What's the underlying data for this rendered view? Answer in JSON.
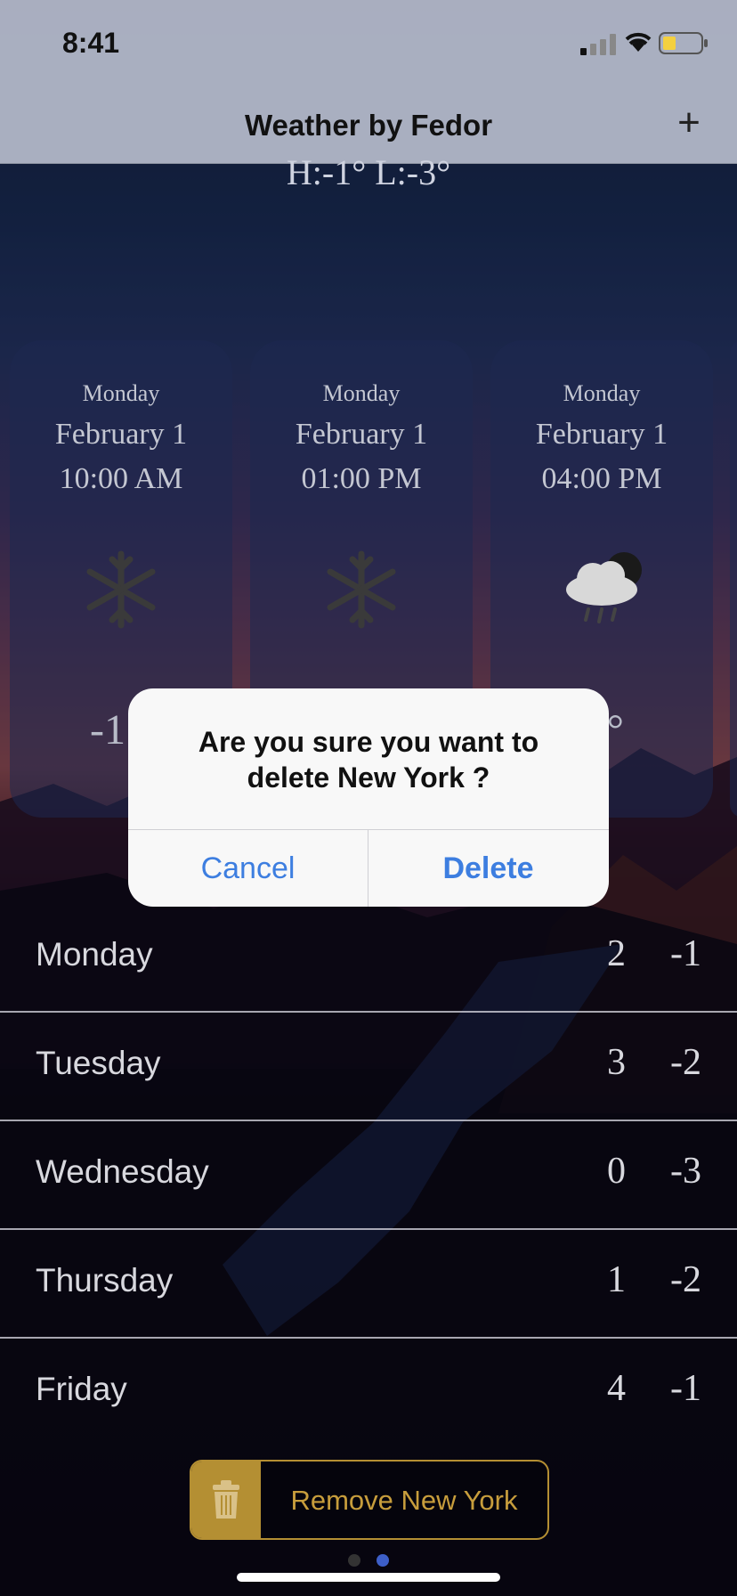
{
  "status": {
    "time": "8:41"
  },
  "nav": {
    "title": "Weather by Fedor",
    "add_label": "+"
  },
  "summary": {
    "high_low": "H:-1° L:-3°"
  },
  "hourly": [
    {
      "day": "Monday",
      "date": "February 1",
      "time": "10:00 AM",
      "icon": "snowflake-icon",
      "temp": "-1"
    },
    {
      "day": "Monday",
      "date": "February 1",
      "time": "01:00 PM",
      "icon": "snowflake-icon",
      "temp": ""
    },
    {
      "day": "Monday",
      "date": "February 1",
      "time": "04:00 PM",
      "icon": "rain-cloud-icon",
      "temp": "°"
    }
  ],
  "daily": [
    {
      "day": "Monday",
      "hi": "2",
      "lo": "-1"
    },
    {
      "day": "Tuesday",
      "hi": "3",
      "lo": "-2"
    },
    {
      "day": "Wednesday",
      "hi": "0",
      "lo": "-3"
    },
    {
      "day": "Thursday",
      "hi": "1",
      "lo": "-2"
    },
    {
      "day": "Friday",
      "hi": "4",
      "lo": "-1"
    }
  ],
  "remove_button": {
    "label": "Remove New York",
    "icon": "trash-icon"
  },
  "page_dots": {
    "count": 2,
    "active": 1
  },
  "dialog": {
    "message": "Are you sure you want to delete New York ?",
    "cancel": "Cancel",
    "delete": "Delete"
  },
  "colors": {
    "accent": "#b48f33",
    "dialog_button": "#3d7ee0"
  }
}
